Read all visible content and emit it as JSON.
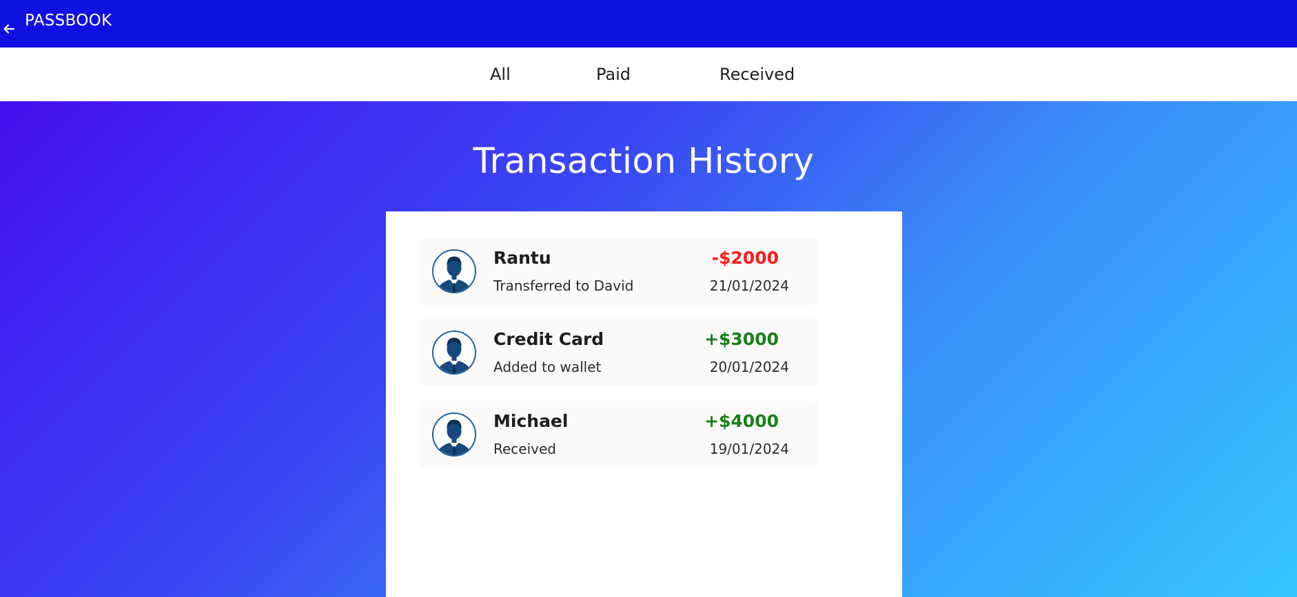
{
  "header": {
    "title": "PASSBOOK",
    "back_icon": "arrow-left-icon",
    "color": "#1010e0"
  },
  "tabs": [
    {
      "label": "All"
    },
    {
      "label": "Paid"
    },
    {
      "label": "Received"
    }
  ],
  "page": {
    "title": "Transaction History",
    "gradient_colors": [
      "#4510f0",
      "#3a48f4",
      "#3a8cf8",
      "#34c6ff"
    ]
  },
  "transactions": [
    {
      "name": "Rantu",
      "description": "Transferred to David",
      "amount": "-$2000",
      "date": "21/01/2024",
      "amount_color": "#ff1a1a",
      "avatar_icon": "user-avatar-icon"
    },
    {
      "name": "Credit Card",
      "description": "Added to wallet",
      "amount": "+$3000",
      "date": "20/01/2024",
      "amount_color": "#1a7f1a",
      "avatar_icon": "user-avatar-icon"
    },
    {
      "name": "Michael",
      "description": "Received",
      "amount": "+$4000",
      "date": "19/01/2024",
      "amount_color": "#1a7f1a",
      "avatar_icon": "user-avatar-icon"
    }
  ]
}
